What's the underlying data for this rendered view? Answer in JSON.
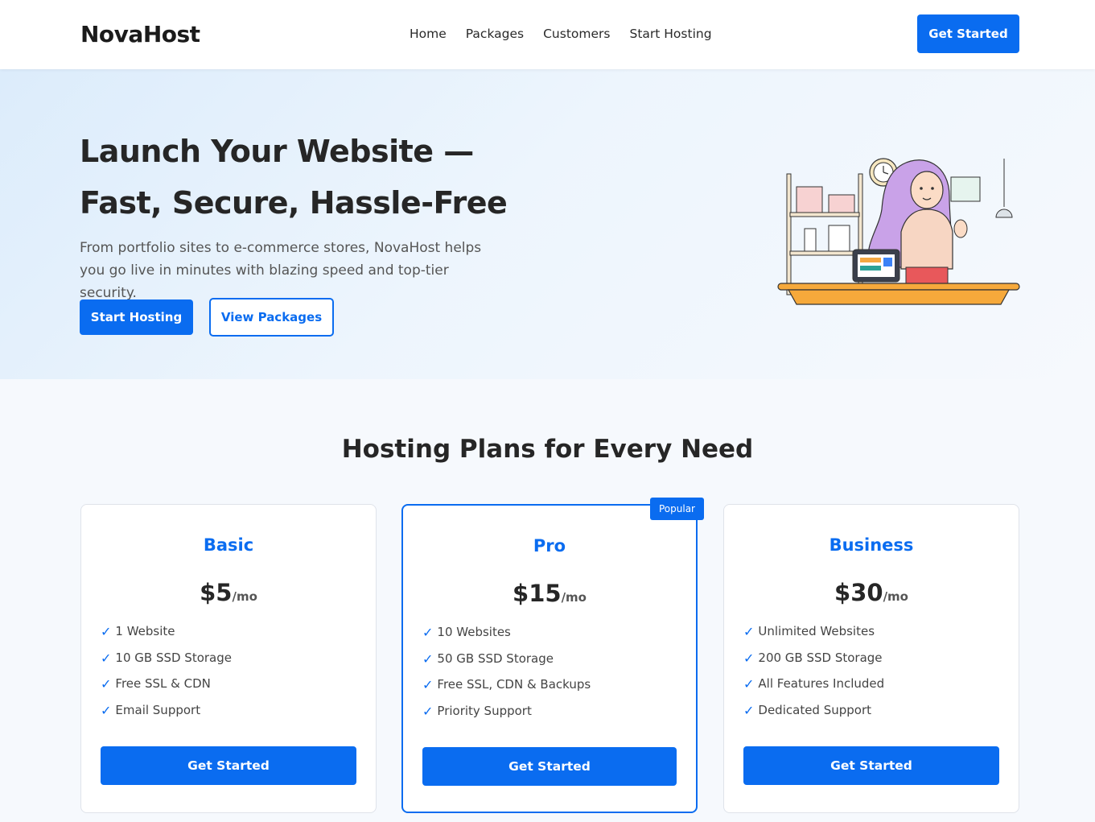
{
  "header": {
    "logo": "NovaHost",
    "nav": [
      {
        "label": "Home"
      },
      {
        "label": "Packages"
      },
      {
        "label": "Customers"
      },
      {
        "label": "Start Hosting"
      }
    ],
    "cta_label": "Get Started"
  },
  "hero": {
    "title_line1": "Launch Your Website —",
    "title_line2": "Fast, Secure, Hassle-Free",
    "description": "From portfolio sites to e-commerce stores, NovaHost helps you go live in minutes with blazing speed and top-tier security.",
    "primary_button": "Start Hosting",
    "secondary_button": "View Packages",
    "illustration_icon": "woman-at-desk-illustration"
  },
  "plans": {
    "title": "Hosting Plans for Every Need",
    "items": [
      {
        "name": "Basic",
        "price": "$5",
        "period": "/mo",
        "features": [
          "1 Website",
          "10 GB SSD Storage",
          "Free SSL & CDN",
          "Email Support"
        ],
        "button": "Get Started"
      },
      {
        "name": "Pro",
        "price": "$15",
        "period": "/mo",
        "badge": "Popular",
        "features": [
          "10 Websites",
          "50 GB SSD Storage",
          "Free SSL, CDN & Backups",
          "Priority Support"
        ],
        "button": "Get Started"
      },
      {
        "name": "Business",
        "price": "$30",
        "period": "/mo",
        "features": [
          "Unlimited Websites",
          "200 GB SSD Storage",
          "All Features Included",
          "Dedicated Support"
        ],
        "button": "Get Started"
      }
    ],
    "check_glyph": "✓"
  },
  "colors": {
    "accent": "#0a6cf0",
    "heading": "#262626",
    "hero_bg": "#dcecfb"
  }
}
